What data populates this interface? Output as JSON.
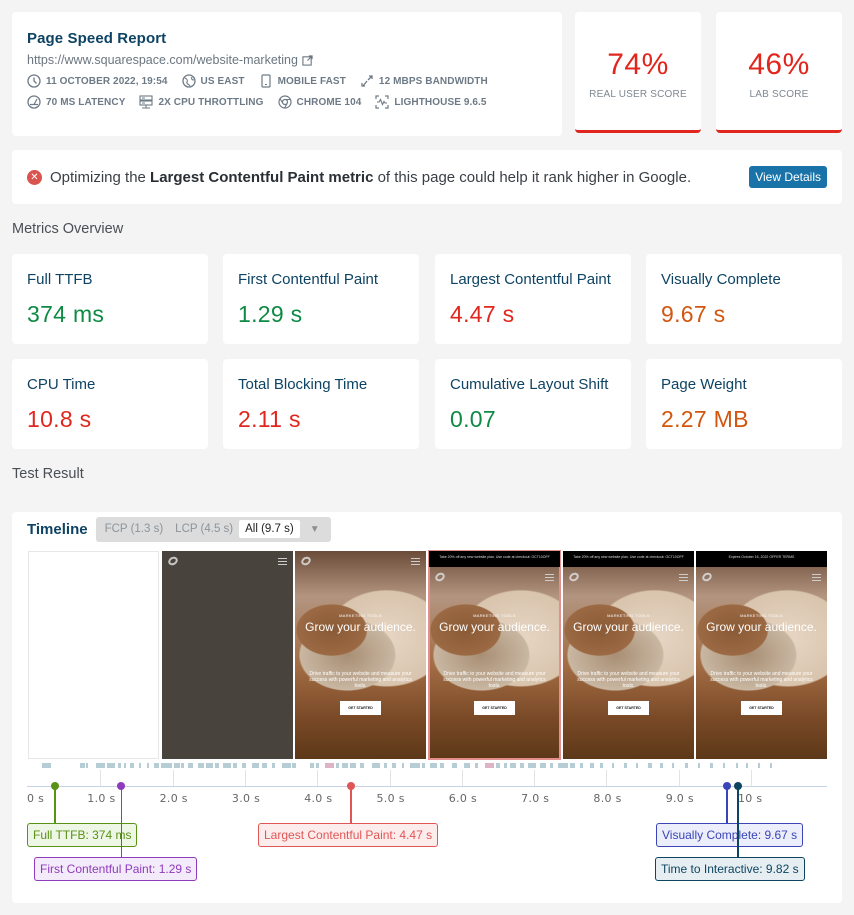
{
  "header": {
    "title": "Page Speed Report",
    "url": "https://www.squarespace.com/website-marketing",
    "meta_row1": [
      {
        "icon": "clock-icon",
        "text": "11 OCTOBER 2022, 19:54"
      },
      {
        "icon": "globe-icon",
        "text": "US EAST"
      },
      {
        "icon": "mobile-icon",
        "text": "MOBILE FAST"
      },
      {
        "icon": "bandwidth-icon",
        "text": "12 MBPS BANDWIDTH"
      }
    ],
    "meta_row2": [
      {
        "icon": "latency-gauge-icon",
        "text": "70 MS LATENCY"
      },
      {
        "icon": "cpu-server-icon",
        "text": "2X CPU THROTTLING"
      },
      {
        "icon": "chrome-icon",
        "text": "CHROME 104"
      },
      {
        "icon": "lighthouse-icon",
        "text": "LIGHTHOUSE 9.6.5"
      }
    ]
  },
  "scores": {
    "real_user": {
      "value": "74%",
      "label": "REAL USER SCORE"
    },
    "lab": {
      "value": "46%",
      "label": "LAB SCORE"
    }
  },
  "alert": {
    "prefix": "Optimizing the ",
    "highlight": "Largest Contentful Paint metric",
    "suffix": " of this page could help it rank higher in Google.",
    "button": "View Details"
  },
  "sections": {
    "metrics_overview": "Metrics Overview",
    "test_result": "Test Result"
  },
  "metrics": [
    {
      "name": "Full TTFB",
      "value": "374 ms",
      "status": "good"
    },
    {
      "name": "First Contentful Paint",
      "value": "1.29 s",
      "status": "good"
    },
    {
      "name": "Largest Contentful Paint",
      "value": "4.47 s",
      "status": "bad"
    },
    {
      "name": "Visually Complete",
      "value": "9.67 s",
      "status": "warn"
    },
    {
      "name": "CPU Time",
      "value": "10.8 s",
      "status": "bad"
    },
    {
      "name": "Total Blocking Time",
      "value": "2.11 s",
      "status": "bad"
    },
    {
      "name": "Cumulative Layout Shift",
      "value": "0.07",
      "status": "good"
    },
    {
      "name": "Page Weight",
      "value": "2.27 MB",
      "status": "warn"
    }
  ],
  "timeline": {
    "title": "Timeline",
    "filters": [
      {
        "label": "FCP (1.3 s)",
        "active": false
      },
      {
        "label": "LCP (4.5 s)",
        "active": false
      },
      {
        "label": "All (9.7 s)",
        "active": true
      }
    ],
    "frames": [
      {
        "type": "blank"
      },
      {
        "type": "dark"
      },
      {
        "type": "photo",
        "kicker": "MARKETING TOOLS",
        "hero": "Grow your audience.",
        "sub": "Drive traffic to your website and measure your success with powerful marketing and analytics tools.",
        "cta": "GET STARTED"
      },
      {
        "type": "photo",
        "lcp": true,
        "banner": "Take 20% off any new website plan. Use code at checkout: OCT10OFF",
        "kicker": "MARKETING TOOLS",
        "hero": "Grow your audience.",
        "sub": "Drive traffic to your website and measure your success with powerful marketing and analytics tools.",
        "cta": "GET STARTED"
      },
      {
        "type": "photo",
        "banner": "Take 20% off any new website plan. Use code at checkout: OCT10OFF",
        "kicker": "MARKETING TOOLS",
        "hero": "Grow your audience.",
        "sub": "Drive traffic to your website and measure your success with powerful marketing and analytics tools.",
        "cta": "GET STARTED"
      },
      {
        "type": "photo",
        "banner": "Expires October 16, 2022 OFFER TERMS",
        "kicker": "MARKETING TOOLS",
        "hero": "Grow your audience.",
        "sub": "Drive traffic to your website and measure your success with powerful marketing and analytics tools.",
        "cta": "GET STARTED"
      }
    ],
    "axis_ticks": [
      "0 s",
      "1.0 s",
      "2.0 s",
      "3.0 s",
      "4.0 s",
      "5.0 s",
      "6.0 s",
      "7.0 s",
      "8.0 s",
      "9.0 s",
      "10 s"
    ],
    "axis_max_s": 11,
    "markers": [
      {
        "name": "full-ttfb",
        "label": "Full TTFB: 374 ms",
        "time_s": 0.374,
        "color": "#5a9216",
        "bg": "#eef6e6",
        "row": 0
      },
      {
        "name": "first-contentful-paint",
        "label": "First Contentful Paint: 1.29 s",
        "time_s": 1.29,
        "color": "#8e3bbd",
        "bg": "#f3eafa",
        "row": 1
      },
      {
        "name": "largest-contentful-paint",
        "label": "Largest Contentful Paint: 4.47 s",
        "time_s": 4.47,
        "color": "#e05656",
        "bg": "#fdecec",
        "row": 0
      },
      {
        "name": "visually-complete",
        "label": "Visually Complete: 9.67 s",
        "time_s": 9.67,
        "color": "#3a45b8",
        "bg": "#eceefb",
        "row": 0
      },
      {
        "name": "time-to-interactive",
        "label": "Time to Interactive: 9.82 s",
        "time_s": 9.82,
        "color": "#0d4560",
        "bg": "#e6eef2",
        "row": 1
      }
    ]
  },
  "colors": {
    "good": "#0e8a44",
    "bad": "#e0261d",
    "warn": "#d2560f",
    "brand": "#0e4363",
    "button": "#1a73a8"
  }
}
